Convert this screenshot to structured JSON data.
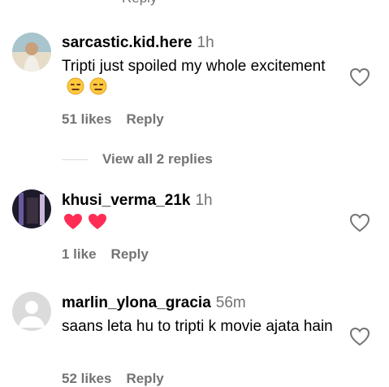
{
  "comments": [
    {
      "username": "sarcastic.kid.here",
      "time": "1h",
      "text": "Tripti just spoiled my whole excitement",
      "emoji": [
        "expressionless-face",
        "expressionless-face"
      ],
      "likes": "51 likes",
      "reply_label": "Reply"
    },
    {
      "username": "khusi_verma_21k",
      "time": "1h",
      "text": "",
      "emoji": [
        "heart",
        "heart"
      ],
      "likes": "1 like",
      "reply_label": "Reply"
    },
    {
      "username": "marlin_ylona_gracia",
      "time": "56m",
      "text": "saans leta hu to tripti k movie ajata hain",
      "emoji": [],
      "likes": "52 likes",
      "reply_label": "Reply"
    }
  ],
  "view_replies": "View all 2 replies",
  "cut_reply": "Reply",
  "colors": {
    "secondary_text": "#737373",
    "heart_emoji": "#ff2d55",
    "emoji_face": "#ffc83d"
  }
}
